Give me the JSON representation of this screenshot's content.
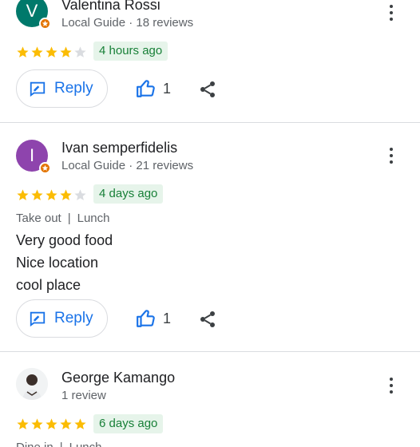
{
  "reviews": [
    {
      "avatar_letter": "V",
      "avatar_color": "#00796b",
      "name": "Valentina Rossi",
      "subtitle": "Local Guide · 18 reviews",
      "rating": 4,
      "time": "4 hours ago",
      "reply_label": "Reply",
      "likes": "1"
    },
    {
      "avatar_letter": "I",
      "avatar_color": "#8e44ad",
      "name": "Ivan semperfidelis",
      "subtitle": "Local Guide · 21 reviews",
      "rating": 4,
      "time": "4 days ago",
      "service": "Take out",
      "meal": "Lunch",
      "text_lines": [
        "Very good food",
        "Nice location",
        "cool place"
      ],
      "reply_label": "Reply",
      "likes": "1"
    },
    {
      "name": "George Kamango",
      "subtitle": "1 review",
      "rating": 5,
      "time": "6 days ago",
      "service": "Dine in",
      "meal": "Lunch"
    }
  ],
  "icons": {
    "more": "more-vert-icon",
    "reply": "reply-edit-icon",
    "like": "thumb-up-icon",
    "share": "share-icon",
    "star": "star-icon",
    "local_guide": "local-guide-badge-icon"
  },
  "colors": {
    "star_filled": "#fbbc04",
    "star_empty": "#dadce0",
    "accent_blue": "#1a73e8",
    "time_badge_bg": "#e6f4ea",
    "time_badge_text": "#188038"
  }
}
